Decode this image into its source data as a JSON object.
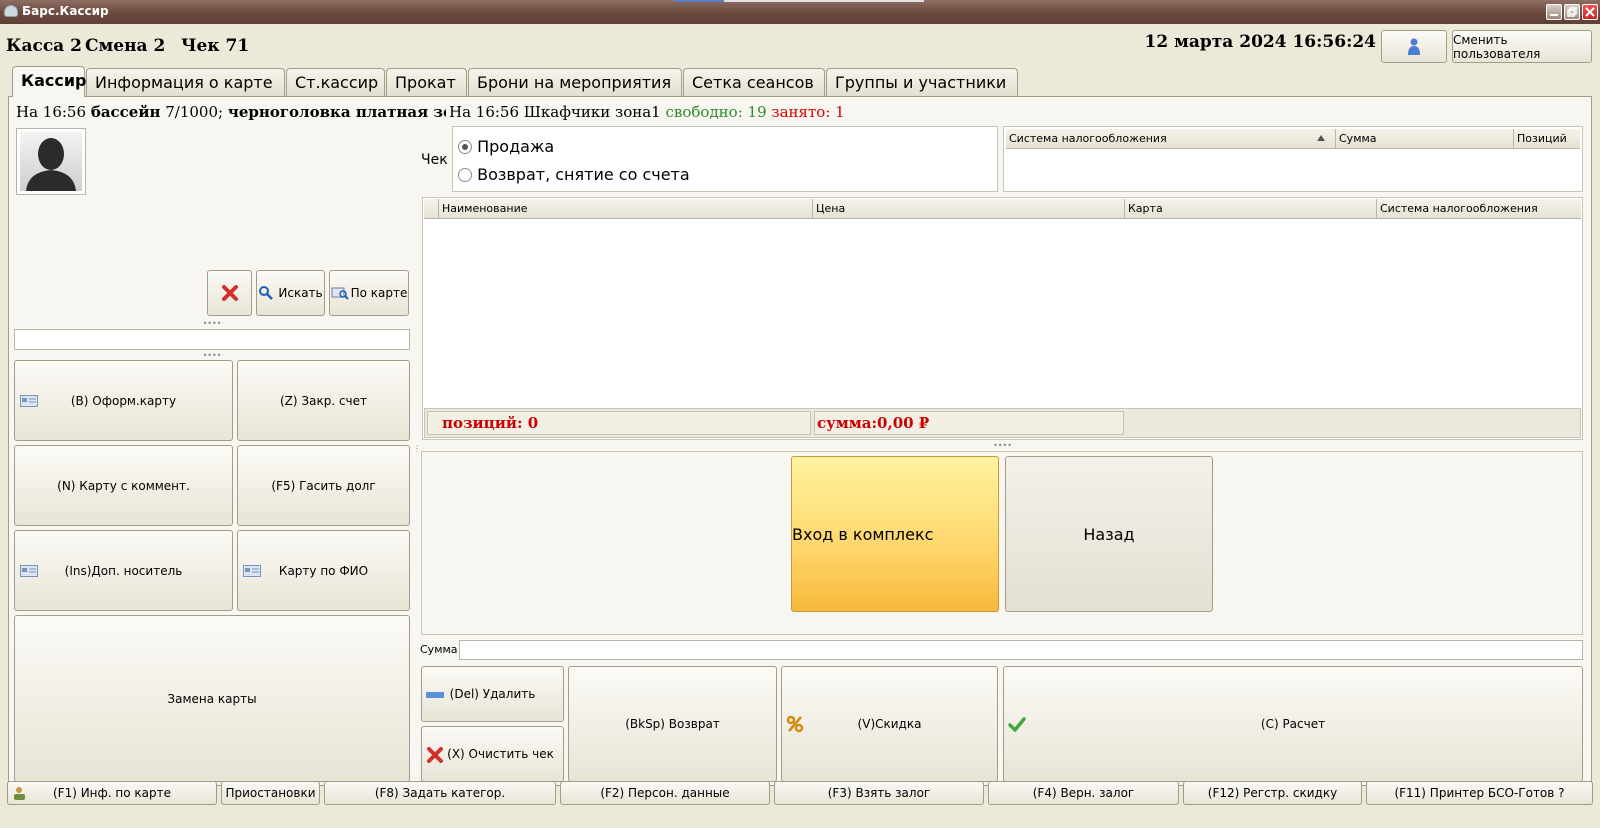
{
  "window": {
    "title": "Барс.Кассир"
  },
  "header": {
    "kassa": "Касса 2",
    "smena": "Смена 2",
    "chek": "Чек 71",
    "datetime": "12 марта 2024 16:56:24",
    "change_user": "Сменить пользователя"
  },
  "tabs": [
    "Кассир",
    "Информация о карте",
    "Ст.кассир",
    "Прокат",
    "Брони на мероприятия",
    "Сетка сеансов",
    "Группы и участники"
  ],
  "occupancy": {
    "prefix": "На 16:56",
    "pool_name": "бассейн",
    "pool_value": "7/1000;",
    "zone": "черноголовка платная зона",
    "sep": ":"
  },
  "lockers": {
    "prefix": "На 16:56 Шкафчики зона1",
    "free": "свободно: 19",
    "busy": "занято: 1"
  },
  "search": {
    "search_label": "Искать",
    "by_card_label": "По карте",
    "input_value": ""
  },
  "left_buttons": {
    "issue_card": "(B) Оформ.карту",
    "close_account": "(Z) Закр. счет",
    "card_comment": "(N) Карту с коммент.",
    "pay_debt": "(F5) Гасить долг",
    "extra_carrier": "(Ins)Доп. носитель",
    "card_by_name": "Карту по ФИО",
    "replace_card": "Замена карты"
  },
  "check": {
    "label": "Чек",
    "sale": "Продажа",
    "refund": "Возврат, снятие со счета",
    "selected": "sale"
  },
  "tax_grid": {
    "columns": [
      "Система налогообложения",
      "Сумма",
      "Позиций"
    ]
  },
  "items_grid": {
    "columns": [
      "Наименование",
      "Цена",
      "Карта",
      "Система налогообложения"
    ],
    "rows": []
  },
  "totals": {
    "positions": "позиций:  0",
    "sum": "сумма:0,00 ₽"
  },
  "actions": {
    "enter_complex": "Вход в комплекс",
    "back": "Назад"
  },
  "sum_field": {
    "label": "Сумма",
    "value": ""
  },
  "bottom_buttons": {
    "delete": "(Del) Удалить",
    "clear": "(X) Очистить чек",
    "return": "(BkSp) Возврат",
    "discount": "(V)Скидка",
    "pay": "(C) Расчет"
  },
  "status_bar": [
    "(F1) Инф. по карте",
    "Приостановки",
    "(F8) Задать категор.",
    "(F2) Персон. данные",
    "(F3) Взять залог",
    "(F4) Верн. залог",
    "(F12) Регстр. скидку",
    "(F11) Принтер БСО-Готов ?"
  ],
  "colors": {
    "accent_yellow": "#ffd56a",
    "total_red": "#cc0000",
    "free_green": "#2e8b2e",
    "busy_red": "#dd0000"
  }
}
